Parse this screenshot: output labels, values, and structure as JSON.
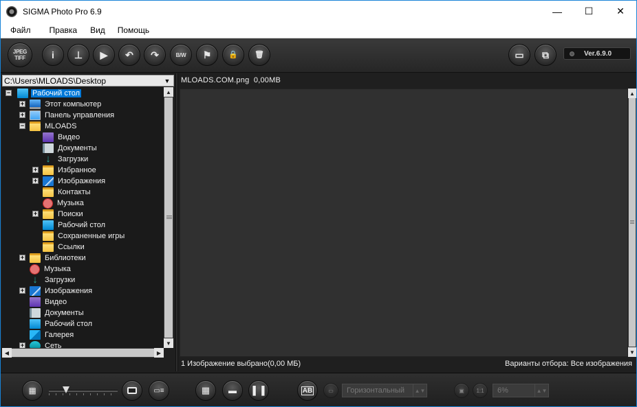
{
  "window": {
    "title": "SIGMA Photo Pro 6.9",
    "controls": {
      "minimize": "—",
      "maximize": "☐",
      "close": "✕"
    }
  },
  "menu": [
    "Файл",
    "Правка",
    "Вид",
    "Помощь"
  ],
  "toolbar": {
    "buttons": [
      {
        "name": "jpeg-tiff-button",
        "label": "JPEG\nTIFF"
      },
      {
        "name": "info-button",
        "label": "i"
      },
      {
        "name": "stamp-button",
        "label": "⊥"
      },
      {
        "name": "slideshow-button",
        "label": "▶"
      },
      {
        "name": "rotate-left-button",
        "label": "↶"
      },
      {
        "name": "rotate-right-button",
        "label": "↷"
      },
      {
        "name": "bw-button",
        "label": "B/W"
      },
      {
        "name": "flag-button",
        "label": "⚑"
      },
      {
        "name": "lock-button",
        "label": "🔒"
      },
      {
        "name": "delete-button",
        "label": "🗑"
      }
    ],
    "right_buttons": [
      {
        "name": "single-window-button",
        "label": "▭"
      },
      {
        "name": "multi-window-button",
        "label": "⧉"
      }
    ],
    "version": "Ver.6.9.0"
  },
  "left_panel": {
    "path": "C:\\Users\\MLOADS\\Desktop",
    "tree": [
      {
        "label": "Рабочий стол",
        "icon": "desktop",
        "level": 0,
        "expander": "−",
        "selected": true
      },
      {
        "label": "Этот компьютер",
        "icon": "pc",
        "level": 1,
        "expander": "+"
      },
      {
        "label": "Панель управления",
        "icon": "panel",
        "level": 1,
        "expander": "+"
      },
      {
        "label": "MLOADS",
        "icon": "folder",
        "level": 1,
        "expander": "−"
      },
      {
        "label": "Видео",
        "icon": "video",
        "level": 2,
        "expander": ""
      },
      {
        "label": "Документы",
        "icon": "docs",
        "level": 2,
        "expander": ""
      },
      {
        "label": "Загрузки",
        "icon": "dl",
        "level": 2,
        "expander": ""
      },
      {
        "label": "Избранное",
        "icon": "folder",
        "level": 2,
        "expander": "+"
      },
      {
        "label": "Изображения",
        "icon": "img",
        "level": 2,
        "expander": "+"
      },
      {
        "label": "Контакты",
        "icon": "folder",
        "level": 2,
        "expander": ""
      },
      {
        "label": "Музыка",
        "icon": "music",
        "level": 2,
        "expander": ""
      },
      {
        "label": "Поиски",
        "icon": "folder",
        "level": 2,
        "expander": "+"
      },
      {
        "label": "Рабочий стол",
        "icon": "desktop",
        "level": 2,
        "expander": ""
      },
      {
        "label": "Сохраненные игры",
        "icon": "folder",
        "level": 2,
        "expander": ""
      },
      {
        "label": "Ссылки",
        "icon": "folder",
        "level": 2,
        "expander": ""
      },
      {
        "label": "Библиотеки",
        "icon": "folder",
        "level": 1,
        "expander": "+"
      },
      {
        "label": "Музыка",
        "icon": "music",
        "level": 1,
        "expander": ""
      },
      {
        "label": "Загрузки",
        "icon": "dl",
        "level": 1,
        "expander": ""
      },
      {
        "label": "Изображения",
        "icon": "img",
        "level": 1,
        "expander": "+"
      },
      {
        "label": "Видео",
        "icon": "video",
        "level": 1,
        "expander": ""
      },
      {
        "label": "Документы",
        "icon": "docs",
        "level": 1,
        "expander": ""
      },
      {
        "label": "Рабочий стол",
        "icon": "desktop",
        "level": 1,
        "expander": ""
      },
      {
        "label": "Галерея",
        "icon": "gal",
        "level": 1,
        "expander": ""
      },
      {
        "label": "Сеть",
        "icon": "net",
        "level": 1,
        "expander": "+"
      }
    ]
  },
  "right_panel": {
    "file_header": "MLOADS.COM.png  0,00MB",
    "status_left": "1 Изображение выбрано(0,00 МБ)",
    "status_right": "Варианты отбора: Все изображения"
  },
  "bottom_bar": {
    "thumb_size_slider": 0.25,
    "orientation_select": "Горизонтальный",
    "zoom_select": "6%"
  },
  "colors": {
    "accent": "#0078d7",
    "panel": "#1a1a1a",
    "viewer": "#303030",
    "toolbar": "#2b2b2b"
  }
}
